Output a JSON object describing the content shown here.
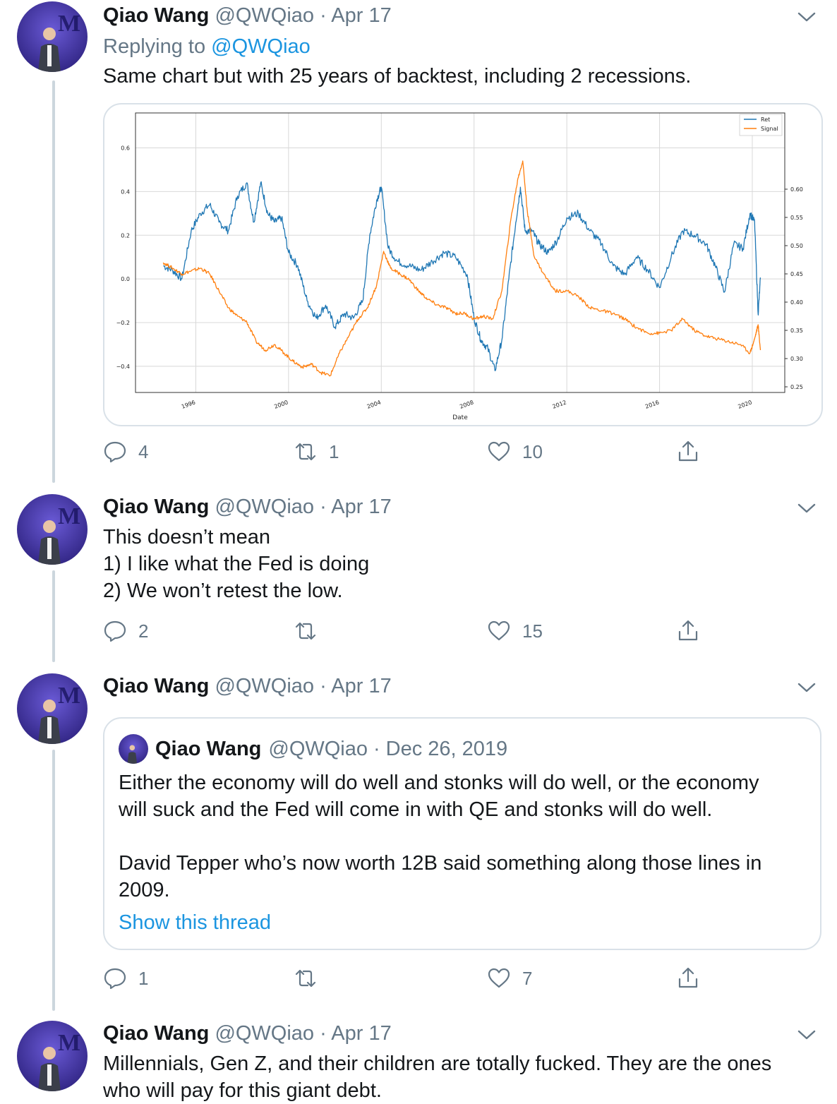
{
  "tweets": [
    {
      "name": "Qiao Wang",
      "handle": "@QWQiao",
      "separator": "·",
      "date": "Apr 17",
      "replying_prefix": "Replying to",
      "replying_handle": "@QWQiao",
      "text": "Same chart but with 25 years of backtest, including 2 recessions.",
      "replies": "4",
      "retweets": "1",
      "likes": "10"
    },
    {
      "name": "Qiao Wang",
      "handle": "@QWQiao",
      "separator": "·",
      "date": "Apr 17",
      "lines": [
        "This doesn’t mean",
        "1) I like what the Fed is doing",
        "2) We won’t retest the low."
      ],
      "replies": "2",
      "retweets": "",
      "likes": "15"
    },
    {
      "name": "Qiao Wang",
      "handle": "@QWQiao",
      "separator": "·",
      "date": "Apr 17",
      "quote": {
        "name": "Qiao Wang",
        "handle": "@QWQiao",
        "separator": "·",
        "date": "Dec 26, 2019",
        "lines": [
          "Either the economy will do well and stonks will do well, or the economy",
          "will suck and the Fed will come in with QE and stonks will do well.",
          "",
          "David Tepper who’s now worth 12B said something along those lines in",
          "2009."
        ],
        "show_thread": "Show this thread"
      },
      "replies": "1",
      "retweets": "",
      "likes": "7"
    },
    {
      "name": "Qiao Wang",
      "handle": "@QWQiao",
      "separator": "·",
      "date": "Apr 17",
      "lines": [
        "Millennials, Gen Z, and their children are totally fucked. They are the ones",
        "who will pay for this giant debt."
      ]
    }
  ],
  "icons": [
    "reply-icon",
    "retweet-icon",
    "like-icon",
    "share-icon",
    "chevron-down-icon"
  ],
  "colors": {
    "accent": "#1b95e0",
    "muted": "#657786",
    "ret_series": "#1f77b4",
    "signal_series": "#ff7f0e"
  },
  "chart_data": {
    "type": "line",
    "title": "",
    "xlabel": "Date",
    "ylabel": "",
    "x_ticks": [
      "1996",
      "2000",
      "2004",
      "2008",
      "2012",
      "2016",
      "2020"
    ],
    "xlim": [
      1993.4,
      2021.4
    ],
    "ylim_left": [
      -0.52,
      0.76
    ],
    "ylim_right": [
      0.24,
      0.735
    ],
    "y_ticks_left": [
      "0.6",
      "0.4",
      "0.2",
      "0.0",
      "−0.2",
      "−0.4"
    ],
    "y_ticks_right": [
      "0.60",
      "0.55",
      "0.50",
      "0.45",
      "0.40",
      "0.35",
      "0.30",
      "0.25"
    ],
    "legend_position": "top-right",
    "grid": true,
    "series": [
      {
        "name": "Ret",
        "axis": "left",
        "x": [
          1994.6,
          1995.0,
          1995.4,
          1995.8,
          1996.2,
          1996.6,
          1997.0,
          1997.4,
          1997.8,
          1998.2,
          1998.5,
          1998.8,
          1999.1,
          1999.4,
          1999.7,
          2000.0,
          2000.4,
          2000.8,
          2001.2,
          2001.6,
          2002.0,
          2002.4,
          2002.8,
          2003.2,
          2003.5,
          2003.8,
          2004.0,
          2004.3,
          2004.7,
          2005.2,
          2005.7,
          2006.2,
          2006.7,
          2007.2,
          2007.7,
          2008.0,
          2008.3,
          2008.6,
          2008.9,
          2009.2,
          2009.5,
          2009.8,
          2010.0,
          2010.2,
          2010.5,
          2010.8,
          2011.2,
          2011.6,
          2012.0,
          2012.5,
          2013.0,
          2013.5,
          2014.0,
          2014.5,
          2015.0,
          2015.5,
          2016.0,
          2016.5,
          2017.0,
          2017.5,
          2018.0,
          2018.4,
          2018.8,
          2019.2,
          2019.6,
          2019.9,
          2020.1,
          2020.25,
          2020.35
        ],
        "y": [
          0.06,
          0.04,
          0.0,
          0.22,
          0.3,
          0.34,
          0.26,
          0.22,
          0.38,
          0.44,
          0.26,
          0.44,
          0.3,
          0.26,
          0.28,
          0.12,
          0.06,
          -0.1,
          -0.18,
          -0.12,
          -0.22,
          -0.16,
          -0.18,
          -0.1,
          0.2,
          0.36,
          0.42,
          0.14,
          0.08,
          0.06,
          0.04,
          0.08,
          0.12,
          0.1,
          0.02,
          -0.18,
          -0.28,
          -0.32,
          -0.42,
          -0.28,
          0.0,
          0.26,
          0.42,
          0.22,
          0.22,
          0.16,
          0.12,
          0.18,
          0.28,
          0.3,
          0.22,
          0.16,
          0.06,
          0.02,
          0.1,
          0.04,
          -0.04,
          0.1,
          0.22,
          0.2,
          0.16,
          0.06,
          -0.06,
          0.16,
          0.14,
          0.3,
          0.26,
          -0.16,
          0.0
        ]
      },
      {
        "name": "Signal",
        "axis": "right",
        "x": [
          1994.6,
          1995.0,
          1995.4,
          1995.8,
          1996.2,
          1996.6,
          1997.0,
          1997.4,
          1997.8,
          1998.2,
          1998.6,
          1999.0,
          1999.4,
          1999.8,
          2000.2,
          2000.6,
          2001.0,
          2001.4,
          2001.8,
          2002.2,
          2002.6,
          2003.0,
          2003.4,
          2003.8,
          2004.1,
          2004.4,
          2004.8,
          2005.2,
          2005.6,
          2006.0,
          2006.4,
          2006.8,
          2007.2,
          2007.6,
          2008.0,
          2008.4,
          2008.8,
          2009.2,
          2009.6,
          2009.9,
          2010.1,
          2010.3,
          2010.6,
          2011.0,
          2011.5,
          2012.0,
          2012.5,
          2013.0,
          2013.5,
          2014.0,
          2014.5,
          2015.0,
          2015.5,
          2016.0,
          2016.5,
          2017.0,
          2017.5,
          2018.0,
          2018.5,
          2019.0,
          2019.5,
          2019.9,
          2020.1,
          2020.25,
          2020.35
        ],
        "y": [
          0.47,
          0.46,
          0.45,
          0.455,
          0.46,
          0.45,
          0.42,
          0.39,
          0.375,
          0.365,
          0.33,
          0.315,
          0.325,
          0.31,
          0.295,
          0.285,
          0.29,
          0.275,
          0.27,
          0.31,
          0.34,
          0.37,
          0.39,
          0.43,
          0.49,
          0.46,
          0.45,
          0.44,
          0.42,
          0.405,
          0.395,
          0.39,
          0.38,
          0.38,
          0.37,
          0.375,
          0.37,
          0.42,
          0.55,
          0.62,
          0.65,
          0.56,
          0.48,
          0.45,
          0.42,
          0.42,
          0.41,
          0.39,
          0.385,
          0.38,
          0.37,
          0.355,
          0.345,
          0.345,
          0.35,
          0.37,
          0.35,
          0.34,
          0.335,
          0.33,
          0.325,
          0.31,
          0.335,
          0.36,
          0.315
        ]
      }
    ]
  }
}
